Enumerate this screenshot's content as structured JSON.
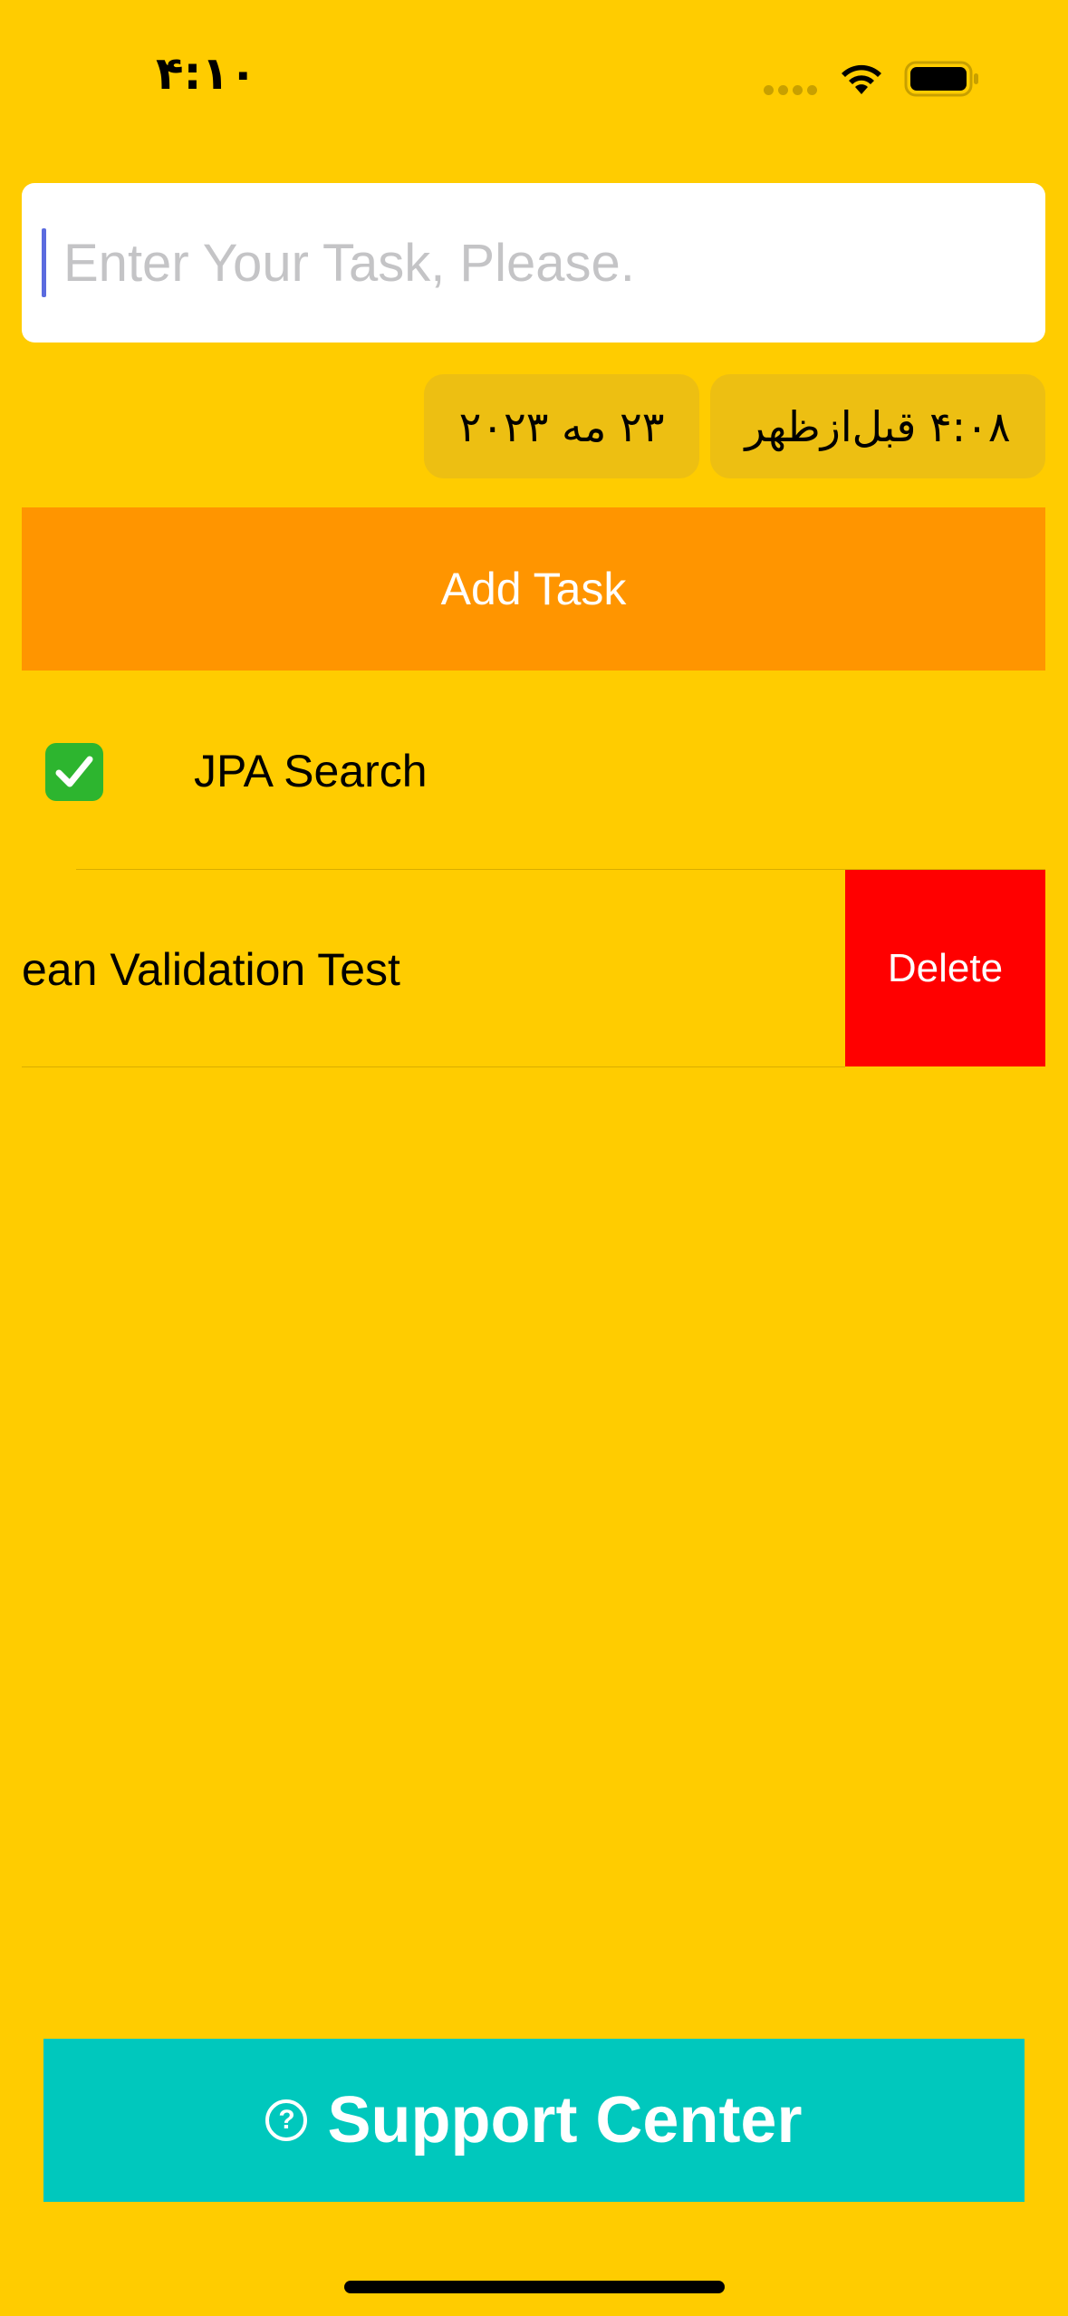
{
  "status_bar": {
    "time": "۴:۱۰"
  },
  "task_input": {
    "value": "",
    "placeholder": "Enter Your Task, Please."
  },
  "date_picker": {
    "date": "۲۳ مه ۲۰۲۳",
    "time": "۴:۰۸ قبل‌ازظهر"
  },
  "add_button": {
    "label": "Add Task"
  },
  "tasks": [
    {
      "check": "✓",
      "label": "JPA Search"
    },
    {
      "label": "ean Validation Test",
      "delete_label": "Delete"
    }
  ],
  "support": {
    "icon": "?",
    "label": "Support Center"
  },
  "colors": {
    "background": "#FFCC00",
    "add_button": "#FF9500",
    "delete_button": "#FF0000",
    "support_button": "#00C8BD",
    "pill": "#EDBF12"
  }
}
